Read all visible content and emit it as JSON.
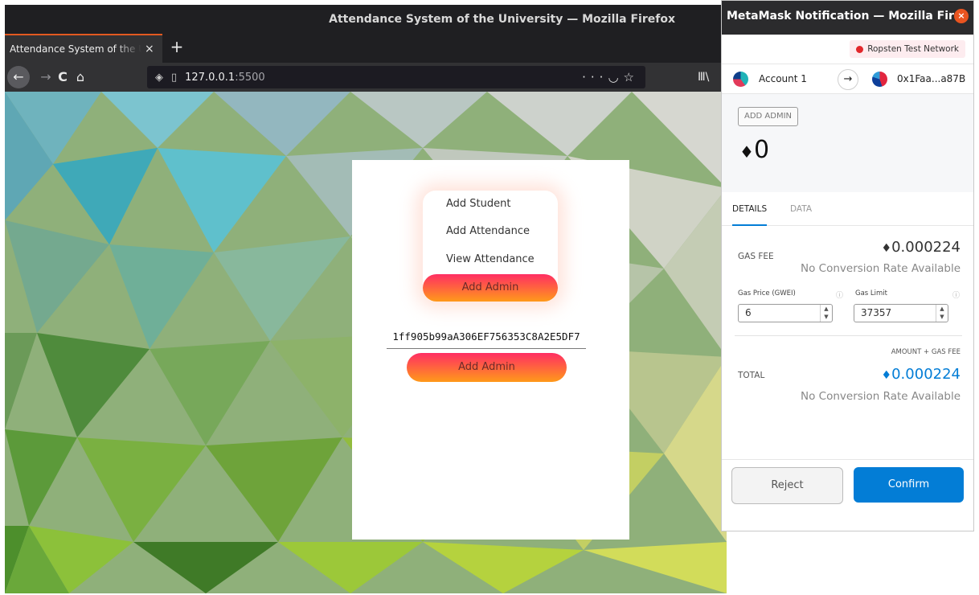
{
  "firefox": {
    "window_title": "Attendance System of the University — Mozilla Firefox",
    "tab_title": "Attendance System of the University",
    "tab_close": "×",
    "new_tab": "+",
    "url_host": "127.0.0.1",
    "url_port": ":5500",
    "icons": [
      "back-icon",
      "forward-icon",
      "reload-icon",
      "home-icon",
      "shield-icon",
      "page-icon",
      "more-icon",
      "pocket-icon",
      "bookmark-star-icon",
      "library-icon"
    ]
  },
  "app": {
    "menu": [
      "Add Student",
      "Add Attendance",
      "View Attendance",
      "Add Admin"
    ],
    "active_menu": "Add Admin",
    "address_value": "1ff905b99aA306EF756353C8A2E5DF7",
    "submit_label": "Add Admin",
    "gradient_colors": [
      "#ff2e63",
      "#ff9a1a"
    ]
  },
  "metamask": {
    "window_title": "MetaMask Notification — Mozilla Fir…",
    "network": "Ropsten Test Network",
    "from_account": "Account 1",
    "to_address": "0x1Faa...a87B",
    "method": "ADD ADMIN",
    "amount": "0",
    "tabs": [
      "DETAILS",
      "DATA"
    ],
    "gas_fee_label": "GAS FEE",
    "gas_fee_value": "0.000224",
    "no_conversion": "No Conversion Rate Available",
    "gas_price_label": "Gas Price (GWEI)",
    "gas_limit_label": "Gas Limit",
    "gas_price": "6",
    "gas_limit": "37357",
    "amount_gas_label": "AMOUNT + GAS FEE",
    "total_label": "TOTAL",
    "total_value": "0.000224",
    "reject_label": "Reject",
    "confirm_label": "Confirm",
    "accent_color": "#037dd6",
    "eth_symbol": "♦"
  }
}
